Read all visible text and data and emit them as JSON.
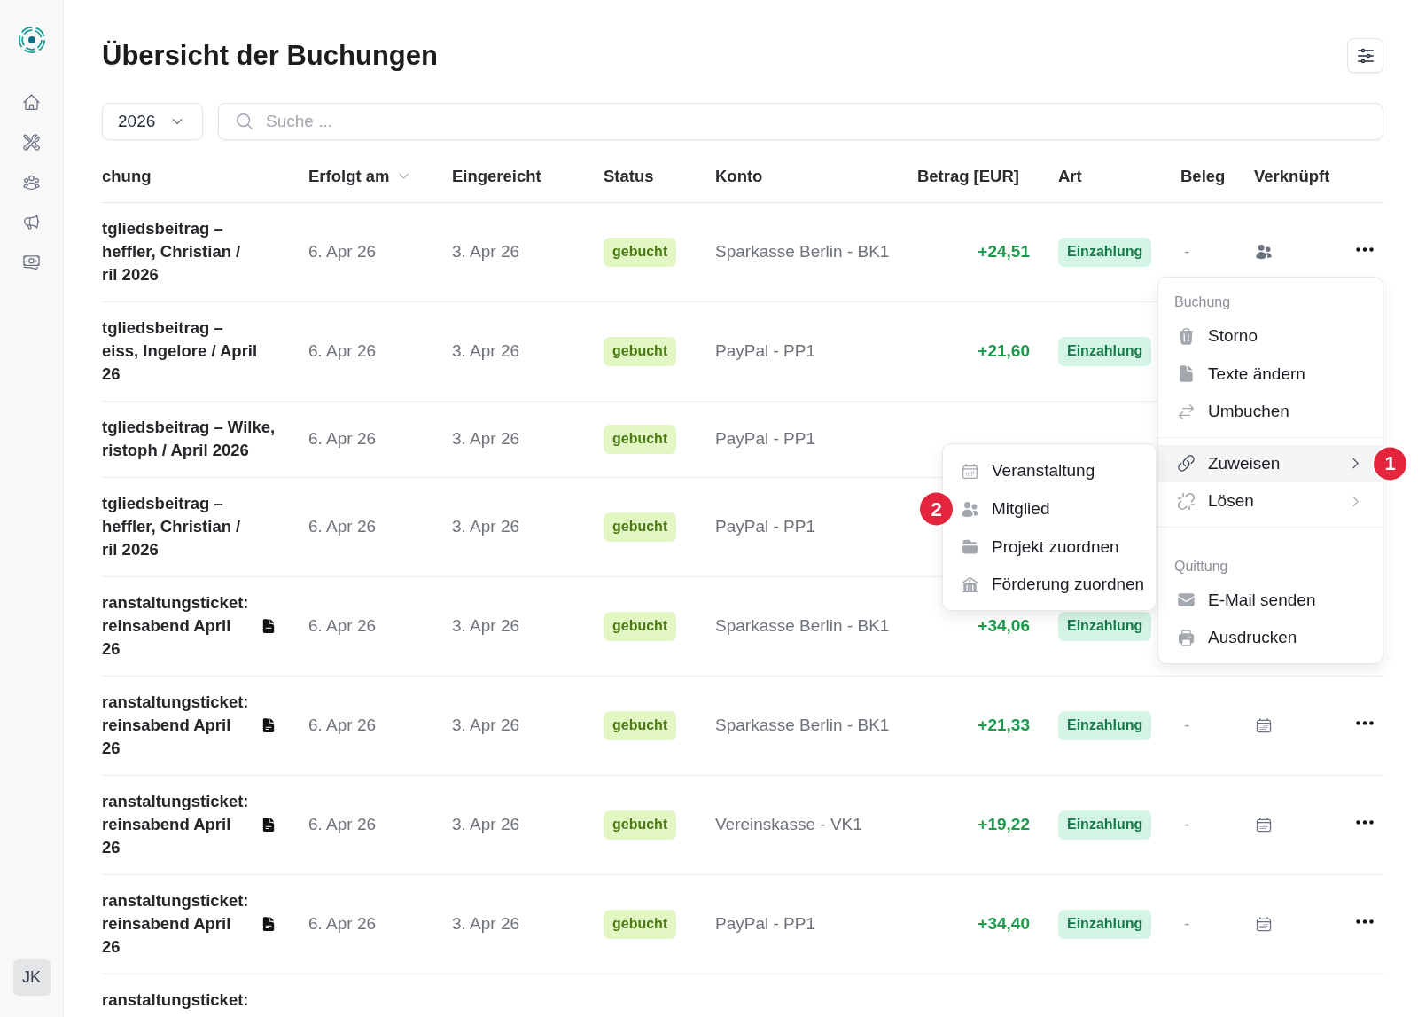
{
  "sidebar": {
    "avatar": "JK"
  },
  "page": {
    "title": "Übersicht der Buchungen"
  },
  "toolbar": {
    "year": "2026",
    "search": {
      "placeholder": "Suche ..."
    }
  },
  "table": {
    "columns": [
      {
        "label": "chung",
        "sorted": false
      },
      {
        "label": "Erfolgt am",
        "sorted": true
      },
      {
        "label": "Eingereicht",
        "sorted": false
      },
      {
        "label": "Status",
        "sorted": false
      },
      {
        "label": "Konto",
        "sorted": false
      },
      {
        "label": "Betrag [EUR]",
        "sorted": false
      },
      {
        "label": "Art",
        "sorted": false
      },
      {
        "label": "Beleg",
        "sorted": false
      },
      {
        "label": "Verknüpft",
        "sorted": false
      }
    ],
    "rows": [
      {
        "description": [
          "tgliedsbeitrag –",
          "heffler, Christian /",
          "ril 2026"
        ],
        "attachment": false,
        "completed": "6. Apr 26",
        "submitted": "3. Apr 26",
        "status": "gebucht",
        "account": "Sparkasse Berlin - BK1",
        "amount": "+24,51",
        "type": "Einzahlung",
        "receipt": "-",
        "linked": {
          "kind": "member"
        },
        "actions": true
      },
      {
        "description": [
          "tgliedsbeitrag –",
          "eiss, Ingelore / April",
          "26"
        ],
        "attachment": false,
        "completed": "6. Apr 26",
        "submitted": "3. Apr 26",
        "status": "gebucht",
        "account": "PayPal - PP1",
        "amount": "+21,60",
        "type": "Einzahlung"
      },
      {
        "description": [
          "tgliedsbeitrag – Wilke,",
          "ristoph / April 2026"
        ],
        "attachment": false,
        "completed": "6. Apr 26",
        "submitted": "3. Apr 26",
        "status": "gebucht",
        "account": "PayPal - PP1"
      },
      {
        "description": [
          "tgliedsbeitrag –",
          "heffler, Christian /",
          "ril 2026"
        ],
        "attachment": false,
        "completed": "6. Apr 26",
        "submitted": "3. Apr 26",
        "status": "gebucht",
        "account": "PayPal - PP1"
      },
      {
        "description": [
          "ranstaltungsticket:",
          "reinsabend April",
          "26"
        ],
        "attachment": true,
        "completed": "6. Apr 26",
        "submitted": "3. Apr 26",
        "status": "gebucht",
        "account": "Sparkasse Berlin - BK1",
        "amount": "+34,06",
        "type": "Einzahlung"
      },
      {
        "description": [
          "ranstaltungsticket:",
          "reinsabend April",
          "26"
        ],
        "attachment": true,
        "completed": "6. Apr 26",
        "submitted": "3. Apr 26",
        "status": "gebucht",
        "account": "Sparkasse Berlin - BK1",
        "amount": "+21,33",
        "type": "Einzahlung",
        "receipt": "-",
        "linked": {
          "kind": "event"
        },
        "actions": true
      },
      {
        "description": [
          "ranstaltungsticket:",
          "reinsabend April",
          "26"
        ],
        "attachment": true,
        "completed": "6. Apr 26",
        "submitted": "3. Apr 26",
        "status": "gebucht",
        "account": "Vereinskasse - VK1",
        "amount": "+19,22",
        "type": "Einzahlung",
        "receipt": "-",
        "linked": {
          "kind": "event"
        },
        "actions": true
      },
      {
        "description": [
          "ranstaltungsticket:",
          "reinsabend April",
          "26"
        ],
        "attachment": true,
        "completed": "6. Apr 26",
        "submitted": "3. Apr 26",
        "status": "gebucht",
        "account": "PayPal - PP1",
        "amount": "+34,40",
        "type": "Einzahlung",
        "receipt": "-",
        "linked": {
          "kind": "event"
        },
        "actions": true
      },
      {
        "description": [
          "ranstaltungsticket:"
        ],
        "attachment": false
      }
    ]
  },
  "row_menu": {
    "sections": [
      {
        "label": "Buchung",
        "items": [
          {
            "label": "Storno",
            "submenu": false,
            "selected": false
          },
          {
            "label": "Texte ändern",
            "submenu": false,
            "selected": false
          },
          {
            "label": "Umbuchen",
            "submenu": false,
            "selected": false
          }
        ]
      },
      {
        "items": [
          {
            "label": "Zuweisen",
            "submenu": true,
            "selected": true,
            "callout": "1"
          },
          {
            "label": "Lösen",
            "submenu": true,
            "selected": false
          }
        ]
      },
      {
        "label": "Quittung",
        "items": [
          {
            "label": "E-Mail senden",
            "submenu": false,
            "selected": false
          },
          {
            "label": "Ausdrucken",
            "submenu": false,
            "selected": false
          }
        ]
      }
    ]
  },
  "submenu": {
    "items": [
      {
        "label": "Veranstaltung",
        "selected": false
      },
      {
        "label": "Mitglied",
        "selected": false,
        "callout": "2"
      },
      {
        "label": "Projekt zuordnen",
        "selected": false
      },
      {
        "label": "Förderung zuordnen",
        "selected": false
      }
    ]
  }
}
